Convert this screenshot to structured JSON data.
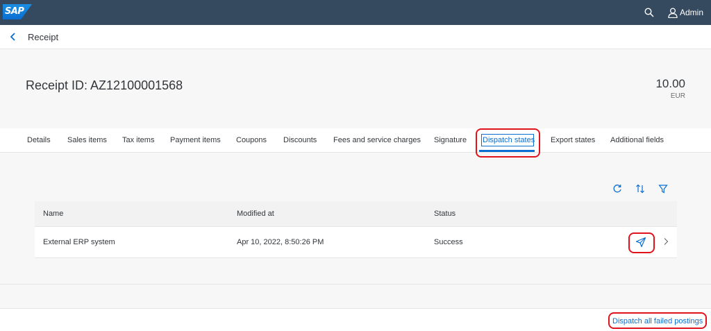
{
  "shell": {
    "logo_text": "SAP",
    "user_name": "Admin"
  },
  "header": {
    "title": "Receipt"
  },
  "object": {
    "title": "Receipt ID: AZ12100001568",
    "amount": "10.00",
    "currency": "EUR"
  },
  "tabs": [
    {
      "label": "Details"
    },
    {
      "label": "Sales items"
    },
    {
      "label": "Tax items"
    },
    {
      "label": "Payment items"
    },
    {
      "label": "Coupons"
    },
    {
      "label": "Discounts"
    },
    {
      "label": "Fees and service charges"
    },
    {
      "label": "Signature"
    },
    {
      "label": "Dispatch states",
      "selected": true
    },
    {
      "label": "Export states"
    },
    {
      "label": "Additional fields"
    }
  ],
  "table": {
    "columns": [
      "Name",
      "Modified at",
      "Status"
    ],
    "rows": [
      {
        "name": "External ERP system",
        "modified_at": "Apr 10, 2022, 8:50:26 PM",
        "status": "Success"
      }
    ]
  },
  "footer": {
    "dispatch_label": "Dispatch all failed postings"
  },
  "colors": {
    "shell": "#354a5f",
    "accent": "#0a6ed1",
    "highlight": "#e0131d"
  },
  "icons": {
    "shell": [
      "search-icon",
      "user-icon"
    ],
    "toolbar": [
      "refresh-icon",
      "sort-icon",
      "filter-icon"
    ],
    "row": [
      "send-icon",
      "chevron-right-icon"
    ],
    "nav": "back-arrow-icon"
  }
}
